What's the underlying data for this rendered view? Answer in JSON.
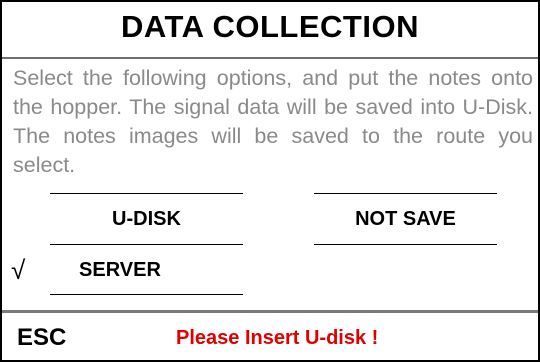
{
  "header": {
    "title": "DATA COLLECTION"
  },
  "description": "Select the following options, and put the notes onto the hopper. The  signal  data will be saved into U-Disk. The notes images will be saved to the route you select.",
  "options": {
    "udisk_label": "U-DISK",
    "notsave_label": "NOT SAVE",
    "server_label": "SERVER",
    "server_checked": true,
    "check_mark": "√"
  },
  "footer": {
    "esc_label": "ESC",
    "status_text": "Please Insert U-disk !",
    "status_color": "#e00000"
  }
}
